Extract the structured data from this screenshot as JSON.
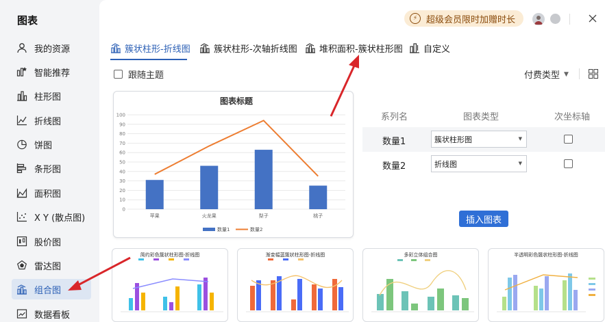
{
  "sidebar": {
    "title": "图表",
    "items": [
      {
        "label": "我的资源",
        "icon": "user-icon"
      },
      {
        "label": "智能推荐",
        "icon": "smart-recommend-icon"
      },
      {
        "label": "柱形图",
        "icon": "bar-chart-icon"
      },
      {
        "label": "折线图",
        "icon": "line-chart-icon"
      },
      {
        "label": "饼图",
        "icon": "pie-chart-icon"
      },
      {
        "label": "条形图",
        "icon": "horizontal-bar-icon"
      },
      {
        "label": "面积图",
        "icon": "area-chart-icon"
      },
      {
        "label": "X Y (散点图)",
        "icon": "scatter-icon"
      },
      {
        "label": "股价图",
        "icon": "stock-chart-icon"
      },
      {
        "label": "雷达图",
        "icon": "radar-chart-icon"
      },
      {
        "label": "组合图",
        "icon": "combo-chart-icon",
        "active": true
      },
      {
        "label": "数据看板",
        "icon": "dashboard-icon"
      }
    ]
  },
  "topbar": {
    "vip_label": "超级会员限时加赠时长",
    "vip_icon": "lightning-icon"
  },
  "tabs": [
    {
      "label": "簇状柱形-折线图",
      "active": true
    },
    {
      "label": "簇状柱形-次轴折线图"
    },
    {
      "label": "堆积面积-簇状柱形图"
    },
    {
      "label": "自定义"
    }
  ],
  "follow_theme_label": "跟随主题",
  "paid_type_label": "付费类型",
  "preview": {
    "chart_data": {
      "type": "bar+line",
      "title": "图表标题",
      "categories": [
        "苹果",
        "火龙果",
        "梨子",
        "桃子"
      ],
      "series": [
        {
          "name": "数量1",
          "type": "bar",
          "color": "#4472c4",
          "values": [
            31,
            46,
            63,
            25
          ]
        },
        {
          "name": "数量2",
          "type": "line",
          "color": "#ed7d31",
          "values": [
            37,
            67,
            94,
            35
          ]
        }
      ],
      "ylim": [
        0,
        100
      ],
      "yticks": [
        0,
        10,
        20,
        30,
        40,
        50,
        60,
        70,
        80,
        90,
        100
      ],
      "grid": true,
      "legend": "bottom"
    }
  },
  "series_table": {
    "headers": [
      "系列名",
      "图表类型",
      "次坐标轴"
    ],
    "rows": [
      {
        "name": "数量1",
        "type": "簇状柱形图",
        "secondary": false
      },
      {
        "name": "数量2",
        "type": "折线图",
        "secondary": false
      }
    ]
  },
  "insert_button_label": "插入图表",
  "thumbnails": [
    {
      "title": "简约彩色簇状柱形图-折线图"
    },
    {
      "title": "渐变幅蓝簇状柱形图-折线图"
    },
    {
      "title": "多彩立体组合图"
    },
    {
      "title": "半透明彩色簇状柱形图-折线图"
    }
  ],
  "colors": {
    "accent": "#2b5fb5",
    "button": "#2f6fd6",
    "annotation_arrow": "#d9262a"
  }
}
